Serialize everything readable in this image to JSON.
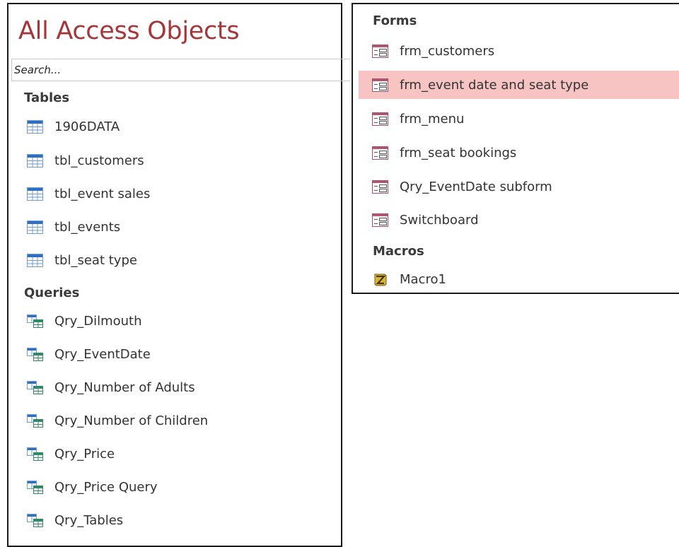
{
  "nav": {
    "title": "All Access Objects",
    "search": {
      "placeholder": "Search...",
      "value": ""
    },
    "groups": {
      "tables": {
        "header": "Tables",
        "items": [
          "1906DATA",
          "tbl_customers",
          "tbl_event sales",
          "tbl_events",
          "tbl_seat type"
        ]
      },
      "queries": {
        "header": "Queries",
        "items": [
          "Qry_Dilmouth",
          "Qry_EventDate",
          "Qry_Number of Adults",
          "Qry_Number of Children",
          "Qry_Price",
          "Qry_Price Query",
          "Qry_Tables"
        ]
      },
      "forms": {
        "header": "Forms",
        "items": [
          "frm_customers",
          "frm_event date and seat type",
          "frm_menu",
          "frm_seat bookings",
          "Qry_EventDate subform",
          "Switchboard"
        ],
        "selected": "frm_event date and seat type"
      },
      "macros": {
        "header": "Macros",
        "items": [
          "Macro1"
        ]
      }
    }
  },
  "icons": {
    "table": "table-icon",
    "query": "query-icon",
    "form": "form-icon",
    "macro": "macro-icon"
  },
  "colors": {
    "title": "#a4373a",
    "selection": "#f7c3c3",
    "text": "#333333",
    "border": "#1a1a1a"
  }
}
